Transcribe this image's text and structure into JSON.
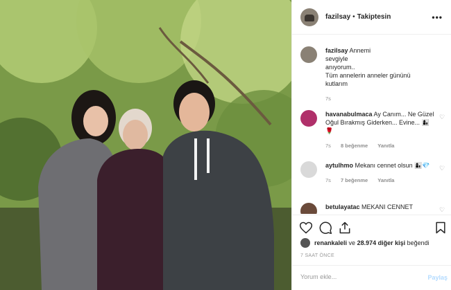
{
  "post": {
    "username": "fazilsay",
    "separator": "•",
    "follow_status": "Takiptesin",
    "more_label": "•••",
    "caption": {
      "username": "fazilsay",
      "lines": [
        "Annemi",
        "sevgiyle",
        "anıyorum..",
        "Tüm annelerin anneler gününü",
        "kutlarım"
      ],
      "time": "7s"
    },
    "comments": [
      {
        "username": "havanabulmaca",
        "text": "Ay Canım... Ne Güzel Oğul Bırakmış Giderken... Evine... 👩‍👦🌹",
        "time": "7s",
        "likes": "8 beğenme",
        "reply": "Yanıtla",
        "avatar_color": "#b0306a"
      },
      {
        "username": "aytulhmo",
        "text": "Mekanı cennet olsun 👩‍👦💎",
        "time": "7s",
        "likes": "7 beğenme",
        "reply": "Yanıtla",
        "avatar_color": "#d9d9d9"
      },
      {
        "username": "betulayatac",
        "text": "MEKANI CENNET",
        "avatar_color": "#6a4a3a"
      }
    ],
    "likes_line": {
      "user": "renankaleli",
      "joiner": "ve",
      "count_text": "28.974 diğer kişi",
      "suffix": "beğendi"
    },
    "timestamp": "7 SAAT ÖNCE",
    "comment_input": {
      "placeholder": "Yorum ekle...",
      "post_label": "Paylaş"
    }
  },
  "icons": [
    "heart-icon",
    "comment-icon",
    "share-icon",
    "bookmark-icon",
    "more-icon"
  ]
}
